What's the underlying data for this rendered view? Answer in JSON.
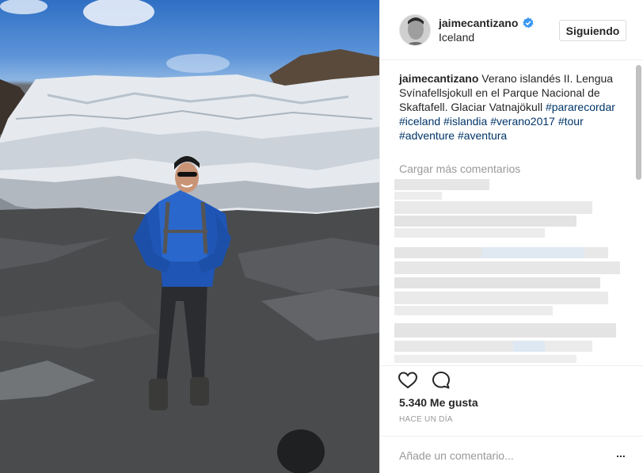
{
  "post": {
    "username": "jaimecantizano",
    "location": "Iceland",
    "follow_label": "Siguiendo",
    "caption_author": "jaimecantizano",
    "caption_text": " Verano islandés II. Lengua Svínafellsjokull en el Parque Nacional de Skaftafell. Glaciar Vatnajökull ",
    "hashtags": [
      "#pararecordar",
      "#iceland",
      "#islandia",
      "#verano2017",
      "#tour",
      "#adventure",
      "#aventura"
    ],
    "load_more_label": "Cargar más comentarios",
    "likes_text": "5.340 Me gusta",
    "timestamp": "HACE UN DÍA",
    "comment_placeholder": "Añade un comentario...",
    "more_options_label": "..."
  },
  "icons": {
    "verified": "verified-badge-icon",
    "like": "heart-icon",
    "comment": "speech-bubble-icon"
  },
  "colors": {
    "hashtag": "#003569",
    "muted": "#999999",
    "verified": "#3897f0",
    "border": "#efefef"
  }
}
